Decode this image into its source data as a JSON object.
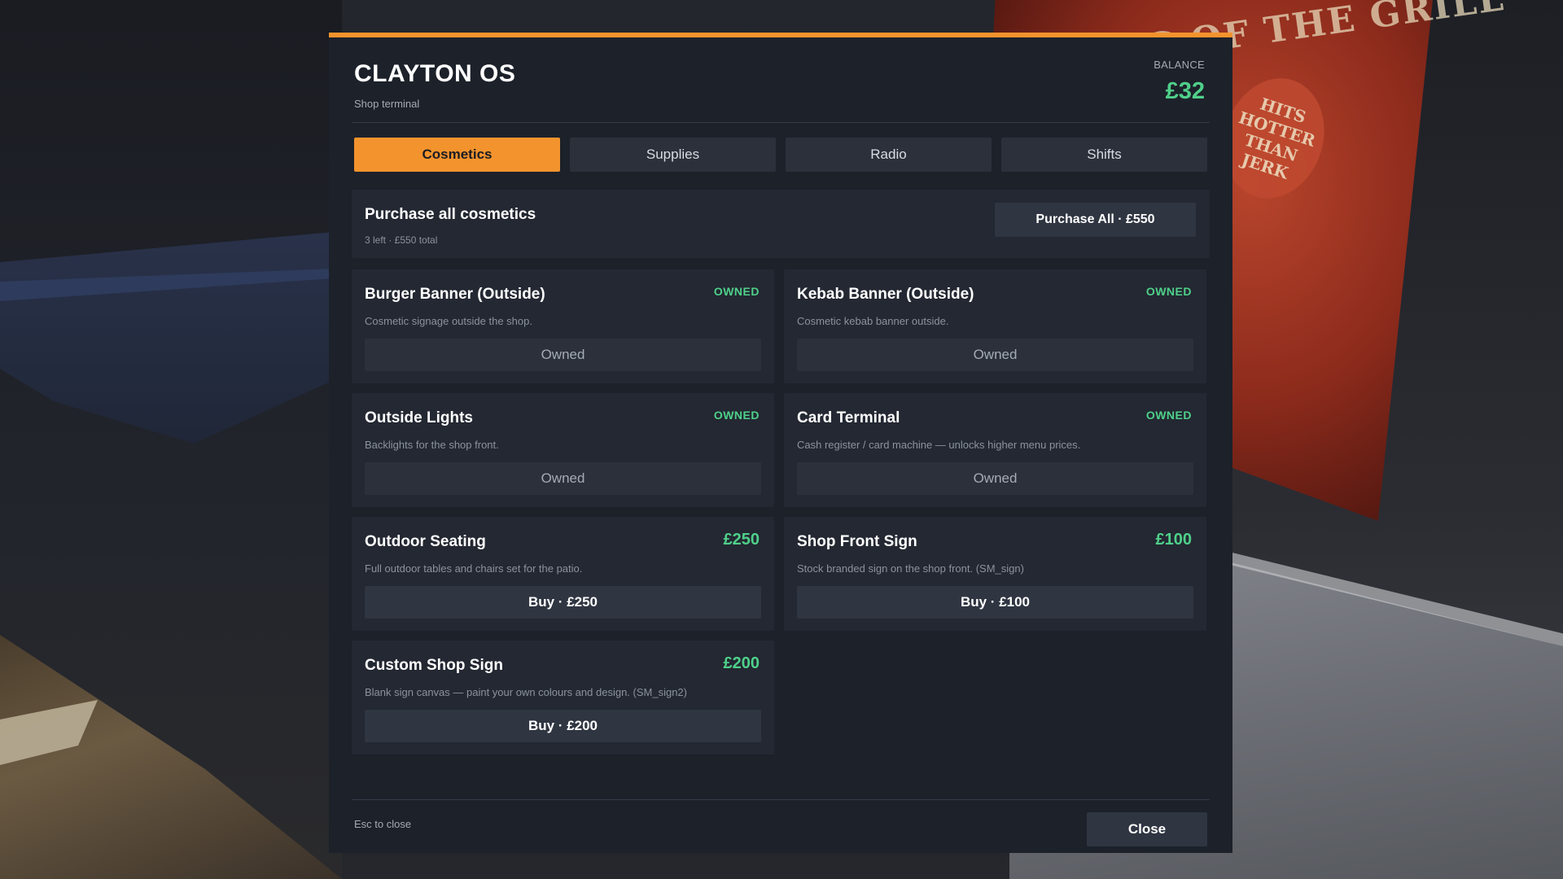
{
  "app": {
    "title": "CLAYTON OS",
    "subtitle": "Shop terminal",
    "balance_label": "BALANCE",
    "balance_value": "£32"
  },
  "tabs": [
    {
      "label": "Cosmetics",
      "active": true
    },
    {
      "label": "Supplies",
      "active": false
    },
    {
      "label": "Radio",
      "active": false
    },
    {
      "label": "Shifts",
      "active": false
    }
  ],
  "purchase_all": {
    "title": "Purchase all cosmetics",
    "meta": "3 left · £550 total",
    "button_label": "Purchase All · £550"
  },
  "items": [
    {
      "name": "Burger Banner (Outside)",
      "description": "Cosmetic signage outside the shop.",
      "status": "OWNED",
      "button_label": "Owned"
    },
    {
      "name": "Kebab Banner (Outside)",
      "description": "Cosmetic kebab banner outside.",
      "status": "OWNED",
      "button_label": "Owned"
    },
    {
      "name": "Outside Lights",
      "description": "Backlights for the shop front.",
      "status": "OWNED",
      "button_label": "Owned"
    },
    {
      "name": "Card Terminal",
      "description": "Cash register / card machine — unlocks higher menu prices.",
      "status": "OWNED",
      "button_label": "Owned"
    },
    {
      "name": "Outdoor Seating",
      "description": "Full outdoor tables and chairs set for the patio.",
      "price": "£250",
      "button_label": "Buy · £250"
    },
    {
      "name": "Shop Front Sign",
      "description": "Stock branded sign on the shop front. (SM_sign)",
      "price": "£100",
      "button_label": "Buy · £100"
    },
    {
      "name": "Custom Shop Sign",
      "description": "Blank sign canvas — paint your own colours and design. (SM_sign2)",
      "price": "£200",
      "button_label": "Buy · £200"
    }
  ],
  "footer": {
    "hint": "Esc to close",
    "close_label": "Close"
  },
  "background": {
    "poster_text": "KING OF THE GRILL",
    "poster_badge": "HITS HOTTER THAN JERK"
  },
  "colors": {
    "accent": "#f3932d",
    "positive": "#4fd08a",
    "panel": "#1c212a",
    "card": "#232832"
  }
}
